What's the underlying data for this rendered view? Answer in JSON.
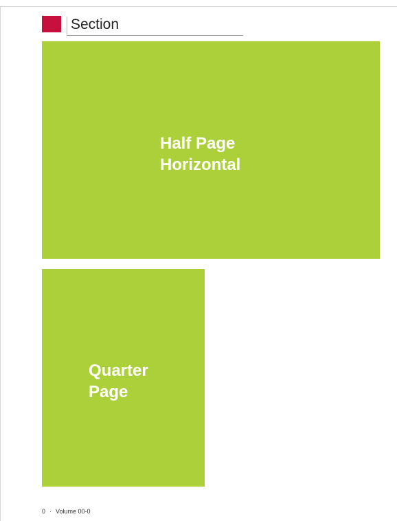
{
  "colors": {
    "accent": "#c8103e",
    "ad_fill": "#acd03a",
    "text": "#222222"
  },
  "header": {
    "title": "Section"
  },
  "ads": {
    "half_page": {
      "line1": "Half Page",
      "line2": "Horizontal"
    },
    "quarter_page": {
      "line1": "Quarter",
      "line2": "Page"
    }
  },
  "footer": {
    "page_number": "0",
    "separator": "·",
    "volume": "Volume 00-0"
  }
}
